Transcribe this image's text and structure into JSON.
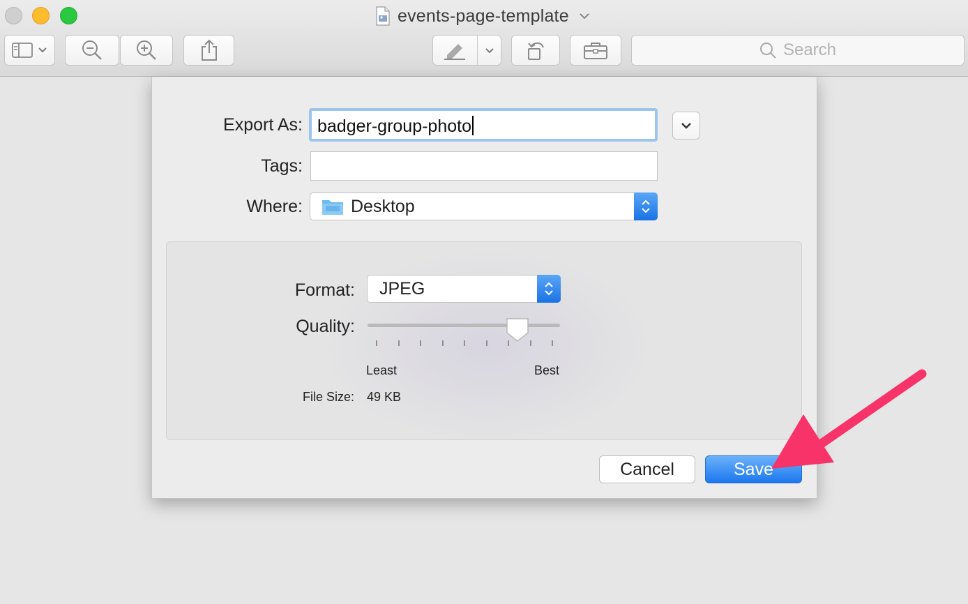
{
  "window": {
    "title": "events-page-template",
    "colors": {
      "close": "#cfcfcf",
      "minimize": "#fdbc2e",
      "maximize": "#2ac840"
    }
  },
  "toolbar": {
    "buttons": [
      {
        "name": "sidebar-toggle-button",
        "icon": "sidebar-icon",
        "has_menu": true
      },
      {
        "name": "zoom-out-button",
        "icon": "zoom-out-icon"
      },
      {
        "name": "zoom-in-button",
        "icon": "zoom-in-icon"
      },
      {
        "name": "share-button",
        "icon": "share-icon"
      },
      {
        "name": "markup-button",
        "icon": "pen-icon",
        "has_menu": true
      },
      {
        "name": "rotate-button",
        "icon": "rotate-icon"
      },
      {
        "name": "toolbox-button",
        "icon": "toolbox-icon"
      }
    ],
    "search_placeholder": "Search"
  },
  "export_dialog": {
    "export_as_label": "Export As:",
    "export_as_value": "badger-group-photo",
    "tags_label": "Tags:",
    "tags_value": "",
    "where_label": "Where:",
    "where_value": "Desktop",
    "where_icon": "folder-icon",
    "format_label": "Format:",
    "format_value": "JPEG",
    "quality_label": "Quality:",
    "quality_level": 0.78,
    "quality_min_label": "Least",
    "quality_max_label": "Best",
    "file_size_label": "File Size:",
    "file_size_value": "49 KB",
    "cancel_label": "Cancel",
    "save_label": "Save",
    "accent_color": "#1c77ef"
  },
  "annotation": {
    "type": "arrow",
    "color": "#f7336a",
    "target": "save-button"
  }
}
